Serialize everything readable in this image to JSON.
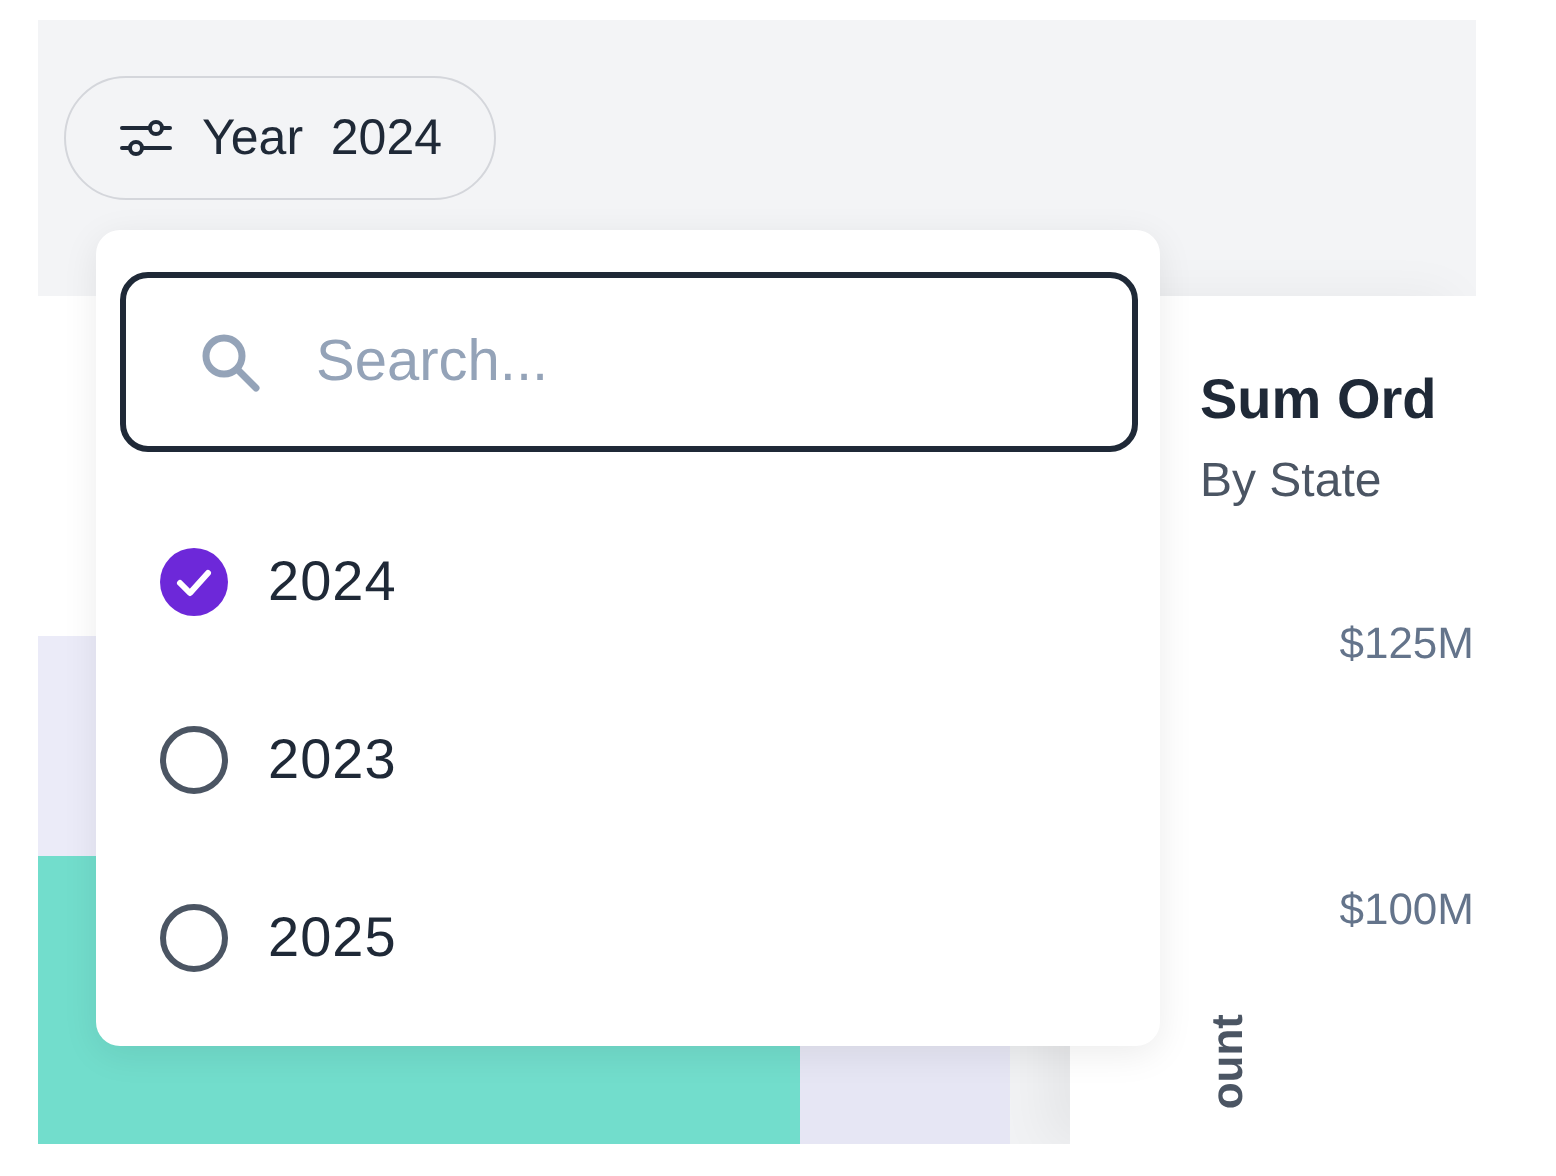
{
  "filter_button": {
    "label": "Year",
    "value": "2024",
    "expanded": true
  },
  "dropdown": {
    "search": {
      "placeholder": "Search..."
    },
    "options": [
      {
        "label": "2024",
        "selected": true
      },
      {
        "label": "2023",
        "selected": false
      },
      {
        "label": "2025",
        "selected": false
      }
    ]
  },
  "chart_card": {
    "title": "Sum Ord",
    "subtitle": "By State",
    "y_ticks": [
      "$125M",
      "$100M"
    ],
    "y_axis_label": "ount"
  }
}
